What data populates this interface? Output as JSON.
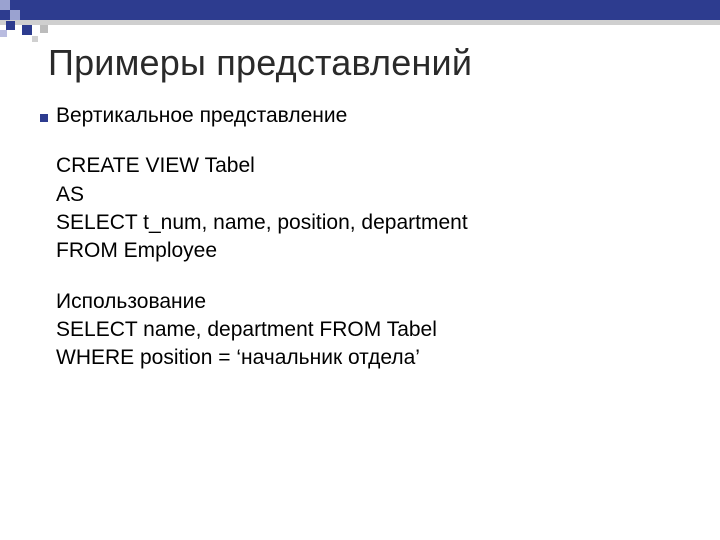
{
  "title": "Примеры представлений",
  "section1_label": "Вертикальное представление",
  "sql": {
    "l1": "CREATE VIEW Tabel",
    "l2": "AS",
    "l3": "SELECT  t_num, name, position, department",
    "l4": "FROM Employee"
  },
  "section2_label": "Использование",
  "usage": {
    "l1": "SELECT name, department FROM Tabel",
    "l2": "WHERE position = ‘начальник отдела’"
  }
}
